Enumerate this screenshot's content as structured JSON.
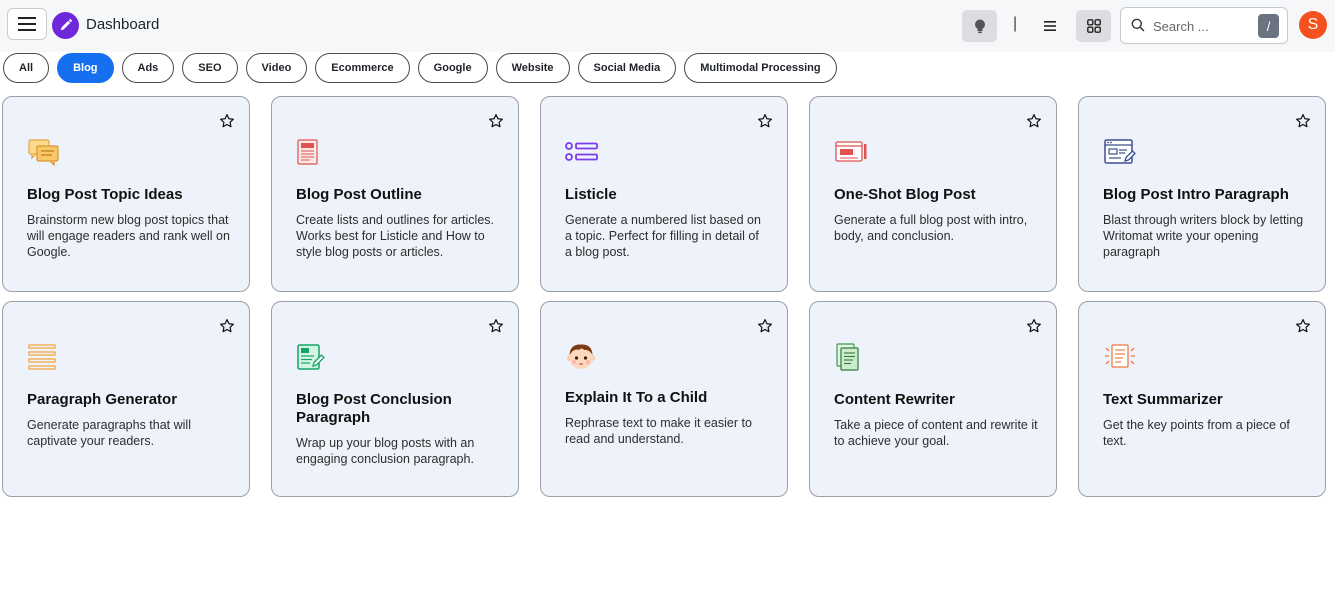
{
  "header": {
    "title": "Dashboard",
    "search_placeholder": "Search ...",
    "search_shortcut": "/",
    "avatar_initial": "S",
    "separator": "|"
  },
  "filters": [
    {
      "label": "All",
      "active": false
    },
    {
      "label": "Blog",
      "active": true
    },
    {
      "label": "Ads",
      "active": false
    },
    {
      "label": "SEO",
      "active": false
    },
    {
      "label": "Video",
      "active": false
    },
    {
      "label": "Ecommerce",
      "active": false
    },
    {
      "label": "Google",
      "active": false
    },
    {
      "label": "Website",
      "active": false
    },
    {
      "label": "Social Media",
      "active": false
    },
    {
      "label": "Multimodal Processing",
      "active": false
    }
  ],
  "cards": [
    {
      "title": "Blog Post Topic Ideas",
      "description": "Brainstorm new blog post topics that will engage readers and rank well on Google.",
      "icon": "chat-bubbles-icon"
    },
    {
      "title": "Blog Post Outline",
      "description": "Create lists and outlines for articles. Works best for Listicle and How to style blog posts or articles.",
      "icon": "blog-document-icon"
    },
    {
      "title": "Listicle",
      "description": "Generate a numbered list based on a topic. Perfect for filling in detail of a blog post.",
      "icon": "bullet-list-icon"
    },
    {
      "title": "One-Shot Blog Post",
      "description": "Generate a full blog post with intro, body, and conclusion.",
      "icon": "blog-window-icon"
    },
    {
      "title": "Blog Post Intro Paragraph",
      "description": "Blast through writers block by letting Writomat write your opening paragraph",
      "icon": "browser-edit-icon"
    },
    {
      "title": "Paragraph Generator",
      "description": "Generate paragraphs that will captivate your readers.",
      "icon": "paragraph-lines-icon"
    },
    {
      "title": "Blog Post Conclusion Paragraph",
      "description": "Wrap up your blog posts with an engaging conclusion paragraph.",
      "icon": "notepad-pen-icon"
    },
    {
      "title": "Explain It To a Child",
      "description": "Rephrase text to make it easier to read and understand.",
      "icon": "child-face-icon"
    },
    {
      "title": "Content Rewriter",
      "description": "Take a piece of content and rewrite it to achieve your goal.",
      "icon": "document-rewrite-icon"
    },
    {
      "title": "Text Summarizer",
      "description": "Get the key points from a piece of text.",
      "icon": "document-summary-icon"
    }
  ],
  "colors": {
    "accent": "#1570ef",
    "logo": "#6d28d9",
    "avatar": "#f4511e",
    "card_bg": "#eef3fb"
  }
}
